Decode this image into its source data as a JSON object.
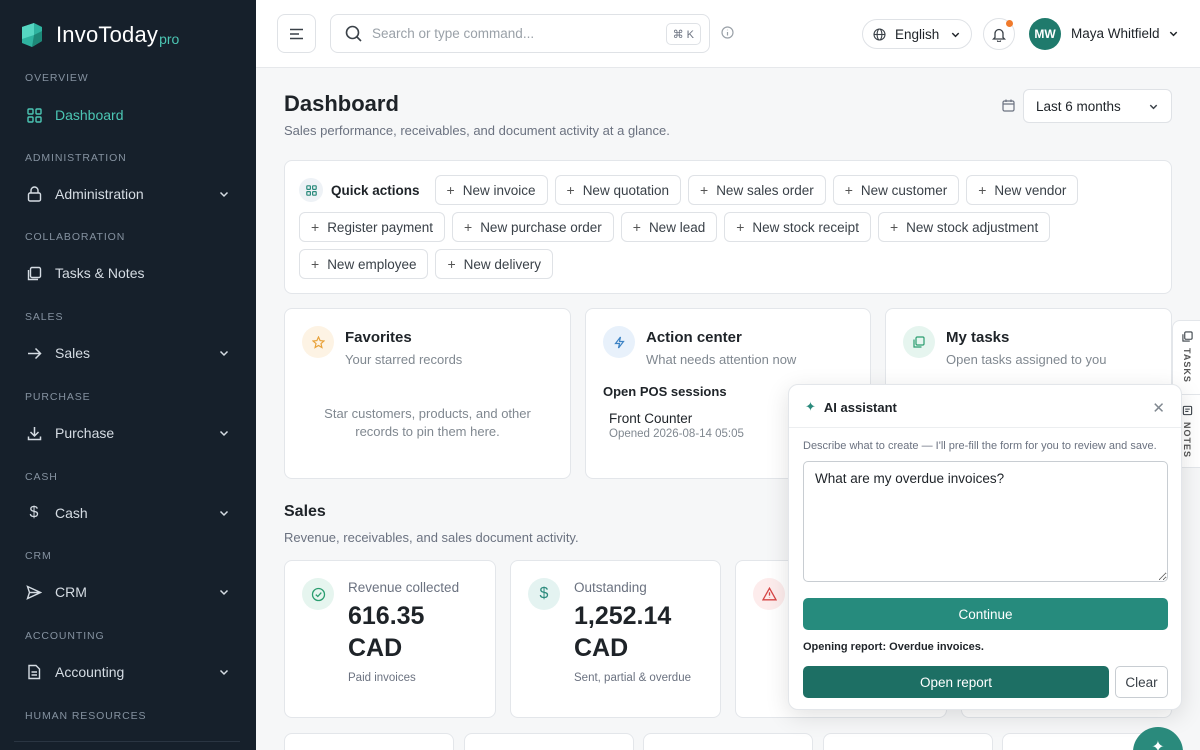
{
  "brand": {
    "name": "InvoToday",
    "suffix": "pro"
  },
  "sidebar": {
    "sections": [
      {
        "title": "OVERVIEW",
        "items": [
          {
            "label": "Dashboard",
            "icon": "grid-icon",
            "active": true,
            "expandable": false
          }
        ]
      },
      {
        "title": "ADMINISTRATION",
        "items": [
          {
            "label": "Administration",
            "icon": "lock-icon",
            "expandable": true
          }
        ]
      },
      {
        "title": "COLLABORATION",
        "items": [
          {
            "label": "Tasks & Notes",
            "icon": "copy-icon",
            "expandable": false
          }
        ]
      },
      {
        "title": "SALES",
        "items": [
          {
            "label": "Sales",
            "icon": "arrow-right-icon",
            "expandable": true
          }
        ]
      },
      {
        "title": "PURCHASE",
        "items": [
          {
            "label": "Purchase",
            "icon": "download-icon",
            "expandable": true
          }
        ]
      },
      {
        "title": "CASH",
        "items": [
          {
            "label": "Cash",
            "icon": "dollar-icon",
            "expandable": true
          }
        ]
      },
      {
        "title": "CRM",
        "items": [
          {
            "label": "CRM",
            "icon": "send-icon",
            "expandable": true
          }
        ]
      },
      {
        "title": "ACCOUNTING",
        "items": [
          {
            "label": "Accounting",
            "icon": "ledger-icon",
            "expandable": true
          }
        ]
      },
      {
        "title": "HUMAN RESOURCES",
        "items": []
      }
    ]
  },
  "topbar": {
    "search_placeholder": "Search or type command...",
    "shortcut": "⌘ K",
    "language": "English",
    "user_initials": "MW",
    "user_name": "Maya Whitfield"
  },
  "page": {
    "title": "Dashboard",
    "subtitle": "Sales performance, receivables, and document activity at a glance.",
    "range": "Last 6 months"
  },
  "quick_actions": {
    "title": "Quick actions",
    "items": [
      "New invoice",
      "New quotation",
      "New sales order",
      "New customer",
      "New vendor",
      "Register payment",
      "New purchase order",
      "New lead",
      "New stock receipt",
      "New stock adjustment",
      "New employee",
      "New delivery"
    ]
  },
  "favorites": {
    "title": "Favorites",
    "subtitle": "Your starred records",
    "empty": "Star customers, products, and other records to pin them here."
  },
  "action_center": {
    "title": "Action center",
    "subtitle": "What needs attention now",
    "pos_heading": "Open POS sessions",
    "pos_name": "Front Counter",
    "pos_opened": "Opened 2026-08-14 05:05"
  },
  "my_tasks": {
    "title": "My tasks",
    "subtitle": "Open tasks assigned to you"
  },
  "sales_section": {
    "title": "Sales",
    "subtitle": "Revenue, receivables, and sales document activity."
  },
  "kpis": [
    {
      "label": "Revenue collected",
      "amount": "616.35",
      "currency": "CAD",
      "note": "Paid invoices",
      "color": "#2a9d6f"
    },
    {
      "label": "Outstanding",
      "amount": "1,252.14",
      "currency": "CAD",
      "note": "Sent, partial & overdue",
      "color": "#2a8a7c"
    },
    {
      "label": "",
      "amount": "",
      "currency": "",
      "note": "",
      "color": "#d64545"
    }
  ],
  "rail": {
    "tasks": "TASKS",
    "notes": "NOTES"
  },
  "ai": {
    "title": "AI assistant",
    "hint": "Describe what to create — I'll pre-fill the form for you to review and save.",
    "input": "What are my overdue invoices?",
    "continue": "Continue",
    "status": "Opening report: Overdue invoices.",
    "open_report": "Open report",
    "clear": "Clear"
  },
  "colors": {
    "accent": "#2a8a7c",
    "sidebar_bg": "#16202b",
    "active": "#4cc6b4"
  }
}
